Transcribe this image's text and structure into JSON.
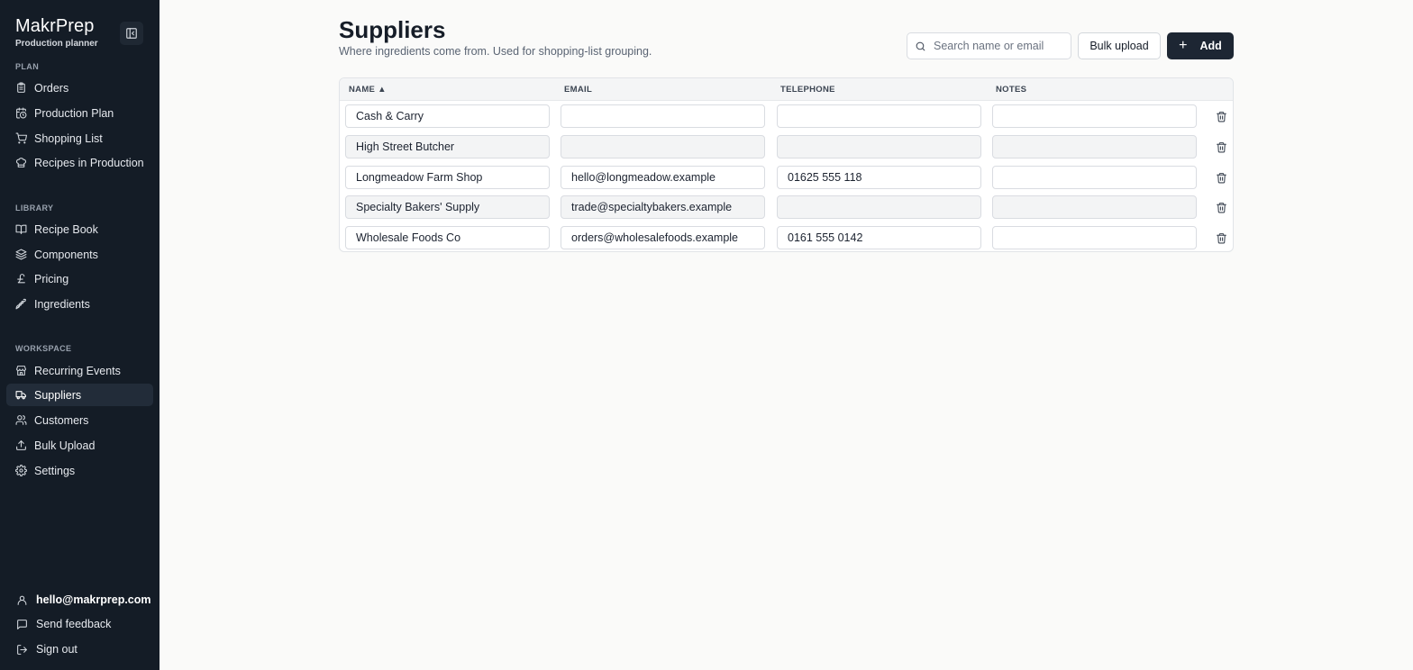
{
  "app": {
    "name": "MakrPrep",
    "subtitle": "Production planner"
  },
  "sidebar": {
    "sections": [
      {
        "label": "PLAN",
        "items": [
          {
            "label": "Orders",
            "icon": "clipboard-icon"
          },
          {
            "label": "Production Plan",
            "icon": "calendar-clock-icon"
          },
          {
            "label": "Shopping List",
            "icon": "cart-icon"
          },
          {
            "label": "Recipes in Production",
            "icon": "chef-hat-icon"
          }
        ]
      },
      {
        "label": "LIBRARY",
        "items": [
          {
            "label": "Recipe Book",
            "icon": "book-icon"
          },
          {
            "label": "Components",
            "icon": "layers-icon"
          },
          {
            "label": "Pricing",
            "icon": "pound-icon"
          },
          {
            "label": "Ingredients",
            "icon": "wheat-icon"
          }
        ]
      },
      {
        "label": "WORKSPACE",
        "items": [
          {
            "label": "Recurring Events",
            "icon": "store-icon"
          },
          {
            "label": "Suppliers",
            "icon": "truck-icon",
            "active": true
          },
          {
            "label": "Customers",
            "icon": "users-icon"
          },
          {
            "label": "Bulk Upload",
            "icon": "upload-icon"
          },
          {
            "label": "Settings",
            "icon": "gear-icon"
          }
        ]
      }
    ],
    "footer": {
      "user_email": "hello@makrprep.com",
      "feedback": "Send feedback",
      "sign_out": "Sign out"
    }
  },
  "page": {
    "title": "Suppliers",
    "subtitle": "Where ingredients come from. Used for shopping-list grouping."
  },
  "toolbar": {
    "search_placeholder": "Search name or email",
    "bulk_upload_label": "Bulk upload",
    "add_label": "Add"
  },
  "table": {
    "columns": [
      "NAME ▲",
      "EMAIL",
      "TELEPHONE",
      "NOTES"
    ],
    "rows": [
      {
        "name": "Cash & Carry",
        "email": "",
        "telephone": "",
        "notes": ""
      },
      {
        "name": "High Street Butcher",
        "email": "",
        "telephone": "",
        "notes": ""
      },
      {
        "name": "Longmeadow Farm Shop",
        "email": "hello@longmeadow.example",
        "telephone": "01625 555 118",
        "notes": ""
      },
      {
        "name": "Specialty Bakers' Supply",
        "email": "trade@specialtybakers.example",
        "telephone": "",
        "notes": ""
      },
      {
        "name": "Wholesale Foods Co",
        "email": "orders@wholesalefoods.example",
        "telephone": "0161 555 0142",
        "notes": ""
      }
    ]
  },
  "colors": {
    "sidebar_bg": "#141c26",
    "sidebar_active": "#222c39",
    "primary_button": "#1d2633",
    "page_bg": "#fafaf9"
  }
}
